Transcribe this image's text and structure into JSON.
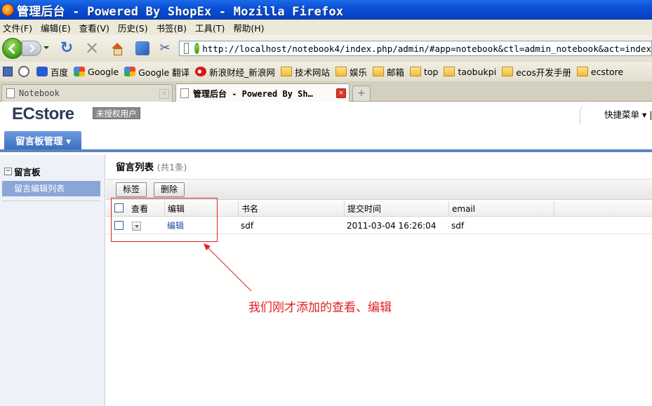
{
  "window": {
    "title": "管理后台 - Powered By ShopEx - Mozilla Firefox"
  },
  "menu": [
    "文件(F)",
    "编辑(E)",
    "查看(V)",
    "历史(S)",
    "书签(B)",
    "工具(T)",
    "帮助(H)"
  ],
  "address": {
    "url": "http://localhost/notebook4/index.php/admin/#app=notebook&ctl=admin_notebook&act=index"
  },
  "bookmarks": [
    {
      "label": "百度",
      "icon": "baidu-icon"
    },
    {
      "label": "Google",
      "icon": "google-icon"
    },
    {
      "label": "Google 翻译",
      "icon": "google-translate-icon"
    },
    {
      "label": "新浪财经_新浪网",
      "icon": "sina-icon"
    },
    {
      "label": "技术网站",
      "icon": "folder-icon"
    },
    {
      "label": "娱乐",
      "icon": "folder-icon"
    },
    {
      "label": "邮箱",
      "icon": "folder-icon"
    },
    {
      "label": "top",
      "icon": "folder-icon"
    },
    {
      "label": "taobukpi",
      "icon": "folder-icon"
    },
    {
      "label": "ecos开发手册",
      "icon": "folder-icon"
    },
    {
      "label": "ecstore",
      "icon": "folder-icon"
    }
  ],
  "tabs": [
    {
      "label": "Notebook"
    },
    {
      "label": "管理后台 - Powered By Sh…"
    }
  ],
  "app": {
    "logo": "ECstore",
    "unauth_badge": "未授权用户",
    "quick_menu": "快捷菜单 ▾ |",
    "nav_tab": "留言板管理 ▾"
  },
  "sidebar": {
    "section": "留言板",
    "toggle": "−",
    "items": [
      "留言编辑列表"
    ]
  },
  "list": {
    "title": "留言列表",
    "count": "(共1条)",
    "buttons": {
      "tag": "标签",
      "delete": "删除"
    },
    "columns": [
      "查看",
      "编辑",
      "书名",
      "提交时间",
      "email"
    ],
    "rows": [
      {
        "edit": "编辑",
        "book": "sdf",
        "time": "2011-03-04 16:26:04",
        "email": "sdf"
      }
    ]
  },
  "annotation": {
    "text": "我们刚才添加的查看、编辑",
    "color": "#e02020"
  }
}
